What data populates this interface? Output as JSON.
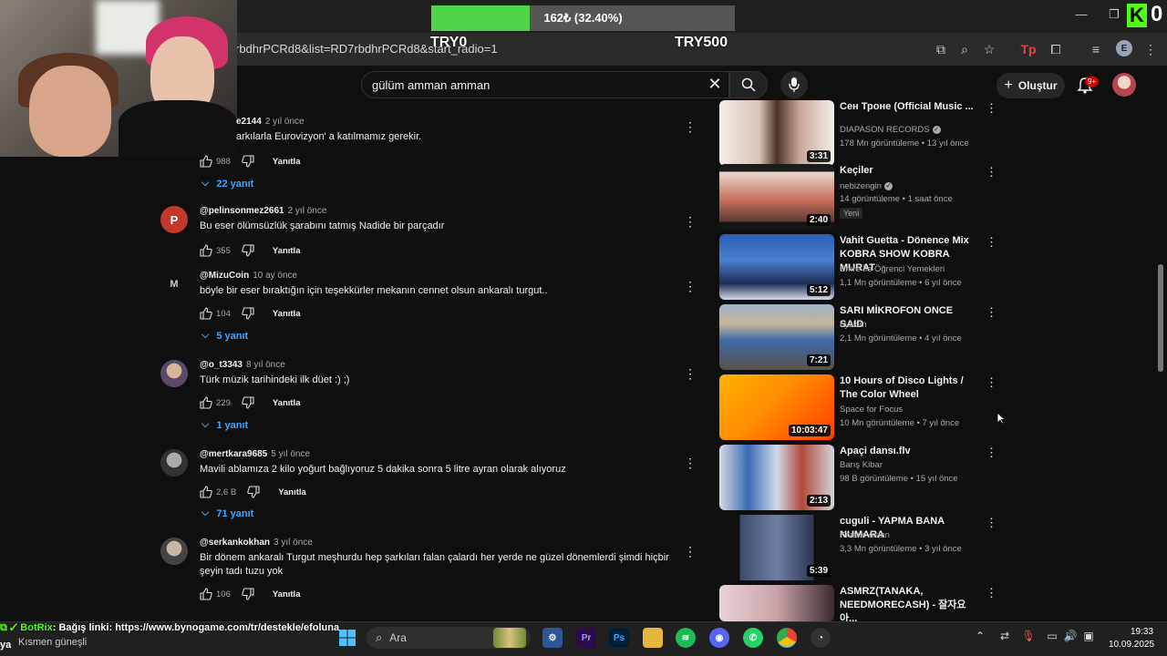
{
  "browser": {
    "url_fragment": "rbdhrPCRd8&list=RD7rbdhrPCRd8&start_radio=1",
    "profile_initial": "E"
  },
  "overlay": {
    "donation_label": "162₺ (32.40%)",
    "donation_progress": 0.324,
    "donation_min": "TRY0",
    "donation_max": "TRY500",
    "kick_logo": "K",
    "kick_count": "0",
    "accent_color": "#53fc18"
  },
  "youtube": {
    "search_value": "gülüm amman amman",
    "create_label": "Oluştur",
    "notification_count": "9+"
  },
  "comments": [
    {
      "user": "e2144",
      "time": "2 yıl önce",
      "text": "arkılarla Eurovizyon' a katılmamız gerekir.",
      "likes": "988",
      "reply": "Yanıtla",
      "replies": "22 yanıt",
      "avatar_letter": ""
    },
    {
      "user": "@pelinsonmez2661",
      "time": "2 yıl önce",
      "text": "Bu eser ölümsüzlük şarabını tatmış Nadide bir parçadır",
      "likes": "355",
      "reply": "Yanıtla",
      "replies": "",
      "avatar_letter": "P"
    },
    {
      "user": "@MizuCoin",
      "time": "10 ay önce",
      "text": "böyle bir eser bıraktığın için teşekkürler mekanın cennet olsun ankaralı turgut..",
      "likes": "104",
      "reply": "Yanıtla",
      "replies": "5 yanıt",
      "avatar_letter": "M"
    },
    {
      "user": "@o_t3343",
      "time": "8 yıl önce",
      "text": "Türk müzik tarihindeki ilk düet  :) ;)",
      "likes": "229",
      "reply": "Yanıtla",
      "replies": "1 yanıt",
      "avatar_letter": ""
    },
    {
      "user": "@mertkara9685",
      "time": "5 yıl önce",
      "text": "Mavili ablamıza 2 kilo yoğurt bağlıyoruz 5 dakika sonra 5 litre ayran olarak alıyoruz",
      "likes": "2,6 B",
      "reply": "Yanıtla",
      "replies": "71 yanıt",
      "avatar_letter": ""
    },
    {
      "user": "@serkankokhan",
      "time": "3 yıl önce",
      "text": "Bir dönem ankaralı Turgut meşhurdu hep şarkıları falan çalardı her yerde ne güzel dönemlerdi şimdi hiçbir şeyin tadı tuzu yok",
      "likes": "106",
      "reply": "Yanıtla",
      "replies": "",
      "avatar_letter": ""
    }
  ],
  "videos": [
    {
      "title": "Сен Троне (Official Music ...",
      "channel": "DIAPASON RECORDS",
      "verified": true,
      "meta": "178 Mn görüntüleme • 13 yıl önce",
      "duration": "3:31",
      "badge": ""
    },
    {
      "title": "Keçiler",
      "channel": "nebizengin",
      "verified": true,
      "meta": "14 görüntüleme • 1 saat önce",
      "duration": "2:40",
      "badge": "Yeni"
    },
    {
      "title": "Vahit Guetta - Dönence Mix KOBRA SHOW KOBRA MURAT",
      "channel": "Emre İle Öğrenci Yemekleri",
      "verified": false,
      "meta": "1,1 Mn görüntüleme • 6 yıl önce",
      "duration": "5:12",
      "badge": ""
    },
    {
      "title": "SARI MİKROFON ONCE SAID",
      "channel": "byzkim",
      "verified": false,
      "meta": "2,1 Mn görüntüleme • 4 yıl önce",
      "duration": "7:21",
      "badge": ""
    },
    {
      "title": "10 Hours of Disco Lights / The Color Wheel",
      "channel": "Space for Focus",
      "verified": false,
      "meta": "10 Mn görüntüleme • 7 yıl önce",
      "duration": "10:03:47",
      "badge": ""
    },
    {
      "title": "Apaçi dansı.flv",
      "channel": "Barış Kibar",
      "verified": false,
      "meta": "98 B görüntüleme • 15 yıl önce",
      "duration": "2:13",
      "badge": ""
    },
    {
      "title": "cuguli - YAPMA BANA NUMARA",
      "channel": "Kıvanc Aslan",
      "verified": false,
      "meta": "3,3 Mn görüntüleme • 3 yıl önce",
      "duration": "5:39",
      "badge": ""
    },
    {
      "title": "ASMRZ(TANAKA, NEEDMORECASH) - 잘자요 아...",
      "channel": "",
      "verified": false,
      "meta": "",
      "duration": "",
      "badge": ""
    }
  ],
  "taskbar": {
    "botrix_name": "BotRix",
    "botrix_message": ": Bağış linki: https://www.bynogame.com/tr/destekle/efoluna",
    "ya": "ya",
    "weather": "Kısmen güneşli",
    "search_placeholder": "Ara",
    "time": "19:33",
    "date": "10.09.2025"
  }
}
